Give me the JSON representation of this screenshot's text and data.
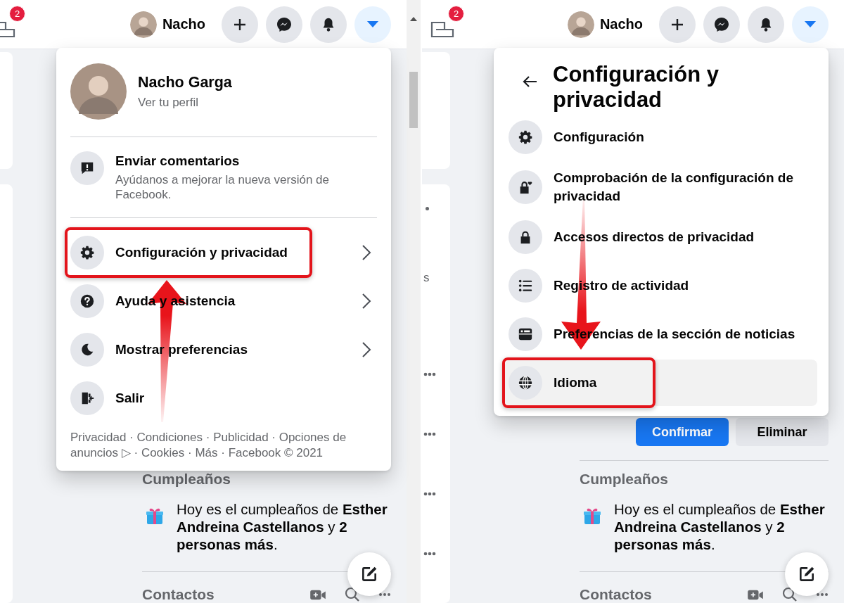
{
  "panels": [
    {
      "header": {
        "badge": "2",
        "user_name": "Nacho",
        "buttons": [
          {
            "kind": "create",
            "selected": false
          },
          {
            "kind": "messenger",
            "selected": false
          },
          {
            "kind": "notifications",
            "selected": false
          },
          {
            "kind": "account",
            "selected": true
          }
        ]
      },
      "scrollbar": true,
      "side": {
        "kind": "cards"
      },
      "menu": {
        "kind": "main",
        "profile": {
          "name": "Nacho Garga",
          "subtitle": "Ver tu perfil"
        },
        "feedback": {
          "title": "Enviar comentarios",
          "subtitle": "Ayúdanos a mejorar la nueva versión de Facebook."
        },
        "items": [
          {
            "kind": "gear",
            "label": "Configuración y privacidad",
            "submenu": true,
            "highlighted": true,
            "hovered": false
          },
          {
            "kind": "question",
            "label": "Ayuda y asistencia",
            "submenu": true,
            "highlighted": false,
            "hovered": false
          },
          {
            "kind": "moon",
            "label": "Mostrar preferencias",
            "submenu": true,
            "highlighted": false,
            "hovered": false
          },
          {
            "kind": "exit",
            "label": "Salir",
            "submenu": false,
            "highlighted": false,
            "hovered": false
          }
        ],
        "footer": "Privacidad · Condiciones · Publicidad · Opciones de anuncios ▷ · Cookies · Más · Facebook © 2021"
      },
      "annotation_arrow": {
        "kind": "up"
      },
      "birthdays": {
        "title": "Cumpleaños",
        "text": "Hoy es el cumpleaños de **Esther Andreina Castellanos** y **2 personas más**."
      },
      "contacts": {
        "title": "Contactos"
      }
    },
    {
      "header": {
        "badge": "2",
        "user_name": "Nacho",
        "buttons": [
          {
            "kind": "create",
            "selected": false
          },
          {
            "kind": "messenger",
            "selected": false
          },
          {
            "kind": "notifications",
            "selected": false
          },
          {
            "kind": "account",
            "selected": true
          }
        ]
      },
      "scrollbar": false,
      "side": {
        "kind": "fragments",
        "items": [
          {
            "kind": "dot"
          },
          {
            "kind": "text",
            "text": "s"
          },
          {
            "kind": "more"
          },
          {
            "kind": "more"
          },
          {
            "kind": "more"
          },
          {
            "kind": "more"
          }
        ]
      },
      "menu": {
        "kind": "settings",
        "title": "Configuración y privacidad",
        "items": [
          {
            "kind": "gear",
            "label": "Configuración",
            "submenu": false,
            "highlighted": false,
            "hovered": false
          },
          {
            "kind": "lock-heart",
            "label": "Comprobación de la configuración de privacidad",
            "submenu": false,
            "highlighted": false,
            "hovered": false
          },
          {
            "kind": "lock",
            "label": "Accesos directos de privacidad",
            "submenu": false,
            "highlighted": false,
            "hovered": false
          },
          {
            "kind": "list",
            "label": "Registro de actividad",
            "submenu": false,
            "highlighted": false,
            "hovered": false
          },
          {
            "kind": "feed",
            "label": "Preferencias de la sección de noticias",
            "submenu": false,
            "highlighted": false,
            "hovered": false
          },
          {
            "kind": "globe",
            "label": "Idioma",
            "submenu": false,
            "highlighted": true,
            "hovered": true
          }
        ]
      },
      "requests": [
        {
          "kind": "primary",
          "label": "Confirmar"
        },
        {
          "kind": "secondary",
          "label": "Eliminar"
        }
      ],
      "annotation_arrow": {
        "kind": "down"
      },
      "birthdays": {
        "title": "Cumpleaños",
        "text": "Hoy es el cumpleaños de **Esther Andreina Castellanos** y **2 personas más**."
      },
      "contacts": {
        "title": "Contactos"
      }
    }
  ]
}
